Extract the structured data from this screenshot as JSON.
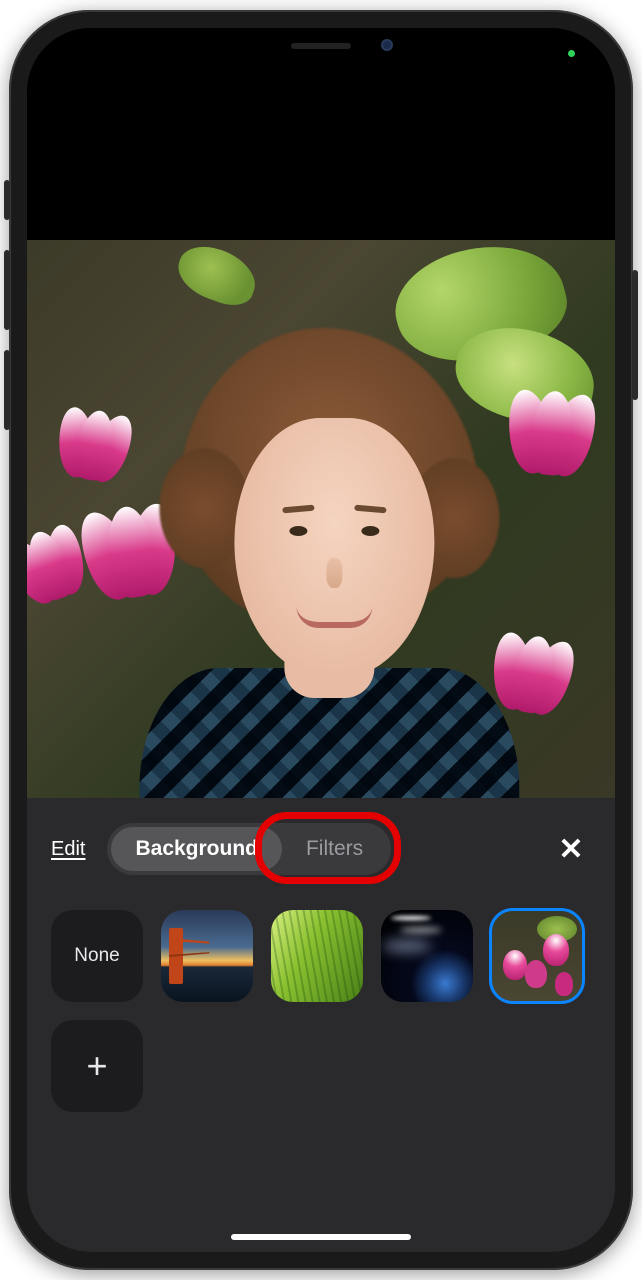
{
  "controls": {
    "edit_label": "Edit",
    "segmented": {
      "background_label": "Background",
      "filters_label": "Filters",
      "active": "Background",
      "highlighted": "Filters"
    },
    "close_icon": "close-icon"
  },
  "backgrounds": {
    "selected_index": 4,
    "items": [
      {
        "id": "none",
        "label": "None",
        "type": "none"
      },
      {
        "id": "bridge",
        "label": "",
        "type": "image",
        "icon": "golden-gate-bridge"
      },
      {
        "id": "grass",
        "label": "",
        "type": "image",
        "icon": "grass"
      },
      {
        "id": "earth",
        "label": "",
        "type": "image",
        "icon": "earth-from-space"
      },
      {
        "id": "tulips",
        "label": "",
        "type": "image",
        "icon": "pink-tulips-garden"
      }
    ],
    "add_label": "+"
  },
  "preview": {
    "applied_background": "pink-tulips-garden",
    "subject": "person-selfie"
  }
}
